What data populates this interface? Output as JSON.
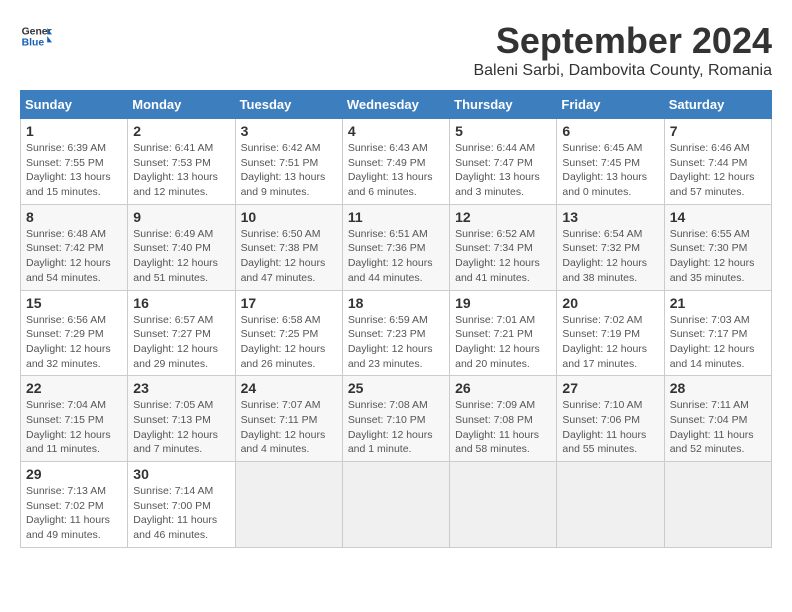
{
  "header": {
    "logo_line1": "General",
    "logo_line2": "Blue",
    "month": "September 2024",
    "location": "Baleni Sarbi, Dambovita County, Romania"
  },
  "weekdays": [
    "Sunday",
    "Monday",
    "Tuesday",
    "Wednesday",
    "Thursday",
    "Friday",
    "Saturday"
  ],
  "weeks": [
    [
      {
        "day": "1",
        "info": "Sunrise: 6:39 AM\nSunset: 7:55 PM\nDaylight: 13 hours\nand 15 minutes."
      },
      {
        "day": "2",
        "info": "Sunrise: 6:41 AM\nSunset: 7:53 PM\nDaylight: 13 hours\nand 12 minutes."
      },
      {
        "day": "3",
        "info": "Sunrise: 6:42 AM\nSunset: 7:51 PM\nDaylight: 13 hours\nand 9 minutes."
      },
      {
        "day": "4",
        "info": "Sunrise: 6:43 AM\nSunset: 7:49 PM\nDaylight: 13 hours\nand 6 minutes."
      },
      {
        "day": "5",
        "info": "Sunrise: 6:44 AM\nSunset: 7:47 PM\nDaylight: 13 hours\nand 3 minutes."
      },
      {
        "day": "6",
        "info": "Sunrise: 6:45 AM\nSunset: 7:45 PM\nDaylight: 13 hours\nand 0 minutes."
      },
      {
        "day": "7",
        "info": "Sunrise: 6:46 AM\nSunset: 7:44 PM\nDaylight: 12 hours\nand 57 minutes."
      }
    ],
    [
      {
        "day": "8",
        "info": "Sunrise: 6:48 AM\nSunset: 7:42 PM\nDaylight: 12 hours\nand 54 minutes."
      },
      {
        "day": "9",
        "info": "Sunrise: 6:49 AM\nSunset: 7:40 PM\nDaylight: 12 hours\nand 51 minutes."
      },
      {
        "day": "10",
        "info": "Sunrise: 6:50 AM\nSunset: 7:38 PM\nDaylight: 12 hours\nand 47 minutes."
      },
      {
        "day": "11",
        "info": "Sunrise: 6:51 AM\nSunset: 7:36 PM\nDaylight: 12 hours\nand 44 minutes."
      },
      {
        "day": "12",
        "info": "Sunrise: 6:52 AM\nSunset: 7:34 PM\nDaylight: 12 hours\nand 41 minutes."
      },
      {
        "day": "13",
        "info": "Sunrise: 6:54 AM\nSunset: 7:32 PM\nDaylight: 12 hours\nand 38 minutes."
      },
      {
        "day": "14",
        "info": "Sunrise: 6:55 AM\nSunset: 7:30 PM\nDaylight: 12 hours\nand 35 minutes."
      }
    ],
    [
      {
        "day": "15",
        "info": "Sunrise: 6:56 AM\nSunset: 7:29 PM\nDaylight: 12 hours\nand 32 minutes."
      },
      {
        "day": "16",
        "info": "Sunrise: 6:57 AM\nSunset: 7:27 PM\nDaylight: 12 hours\nand 29 minutes."
      },
      {
        "day": "17",
        "info": "Sunrise: 6:58 AM\nSunset: 7:25 PM\nDaylight: 12 hours\nand 26 minutes."
      },
      {
        "day": "18",
        "info": "Sunrise: 6:59 AM\nSunset: 7:23 PM\nDaylight: 12 hours\nand 23 minutes."
      },
      {
        "day": "19",
        "info": "Sunrise: 7:01 AM\nSunset: 7:21 PM\nDaylight: 12 hours\nand 20 minutes."
      },
      {
        "day": "20",
        "info": "Sunrise: 7:02 AM\nSunset: 7:19 PM\nDaylight: 12 hours\nand 17 minutes."
      },
      {
        "day": "21",
        "info": "Sunrise: 7:03 AM\nSunset: 7:17 PM\nDaylight: 12 hours\nand 14 minutes."
      }
    ],
    [
      {
        "day": "22",
        "info": "Sunrise: 7:04 AM\nSunset: 7:15 PM\nDaylight: 12 hours\nand 11 minutes."
      },
      {
        "day": "23",
        "info": "Sunrise: 7:05 AM\nSunset: 7:13 PM\nDaylight: 12 hours\nand 7 minutes."
      },
      {
        "day": "24",
        "info": "Sunrise: 7:07 AM\nSunset: 7:11 PM\nDaylight: 12 hours\nand 4 minutes."
      },
      {
        "day": "25",
        "info": "Sunrise: 7:08 AM\nSunset: 7:10 PM\nDaylight: 12 hours\nand 1 minute."
      },
      {
        "day": "26",
        "info": "Sunrise: 7:09 AM\nSunset: 7:08 PM\nDaylight: 11 hours\nand 58 minutes."
      },
      {
        "day": "27",
        "info": "Sunrise: 7:10 AM\nSunset: 7:06 PM\nDaylight: 11 hours\nand 55 minutes."
      },
      {
        "day": "28",
        "info": "Sunrise: 7:11 AM\nSunset: 7:04 PM\nDaylight: 11 hours\nand 52 minutes."
      }
    ],
    [
      {
        "day": "29",
        "info": "Sunrise: 7:13 AM\nSunset: 7:02 PM\nDaylight: 11 hours\nand 49 minutes."
      },
      {
        "day": "30",
        "info": "Sunrise: 7:14 AM\nSunset: 7:00 PM\nDaylight: 11 hours\nand 46 minutes."
      },
      {
        "day": "",
        "info": ""
      },
      {
        "day": "",
        "info": ""
      },
      {
        "day": "",
        "info": ""
      },
      {
        "day": "",
        "info": ""
      },
      {
        "day": "",
        "info": ""
      }
    ]
  ]
}
